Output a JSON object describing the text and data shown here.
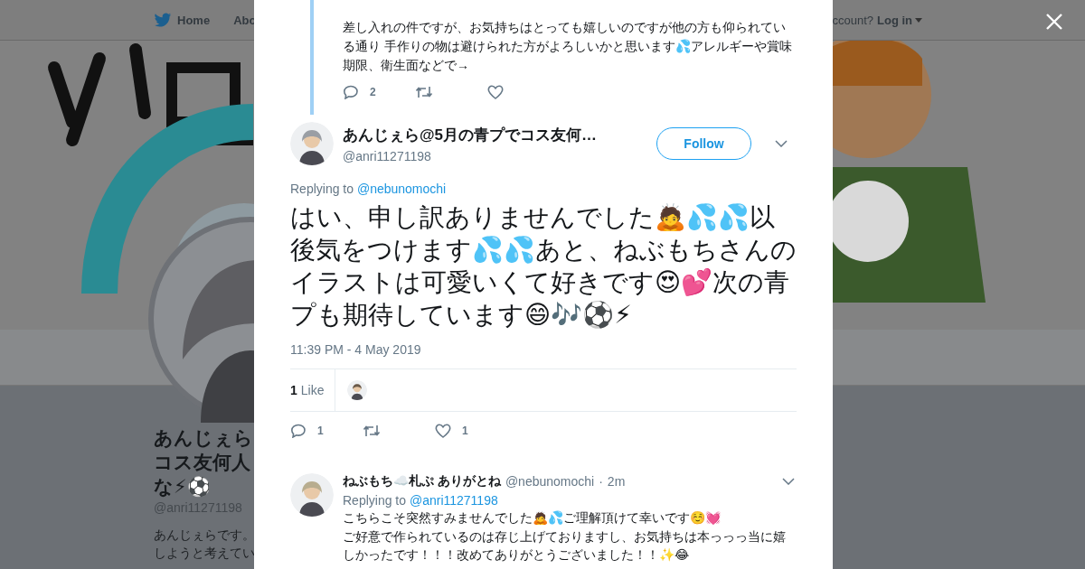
{
  "background_page": {
    "nav": [
      "Home",
      "Abo"
    ],
    "login_prompt": "ccount?",
    "login_label": "Log in",
    "profile": {
      "name_lines": [
        "あんじぇら",
        "コス友何人",
        "な⚡⚽"
      ],
      "handle": "@anri11271198",
      "bio_lines": [
        "あんじぇらです。",
        "しようと考えてい"
      ]
    }
  },
  "parent_tweet": {
    "text": "差し入れの件ですが、お気持ちはとっても嬉しいのですが他の方も仰られている通り 手作りの物は避けられた方がよろしいかと思います💦アレルギーや賞味期限、衛生面などで→",
    "actions": [
      {
        "kind": "reply",
        "count": "2"
      },
      {
        "kind": "retweet"
      },
      {
        "kind": "like"
      }
    ]
  },
  "tweet": {
    "name": "あんじぇら@5月の青プでコス友何…",
    "handle": "@anri11271198",
    "follow_label": "Follow",
    "replying_prefix": "Replying to",
    "replying_to": "@nebunomochi",
    "text": "はい、申し訳ありませんでした🙇💦💦以後気をつけます💦💦あと、ねぶもちさんのイラストは可愛いくて好きです😍💕次の青プも期待しています😄🎶⚽⚡",
    "timestamp": "11:39 PM - 4 May 2019",
    "likes_count": "1",
    "likes_label": "Like",
    "actions": [
      {
        "kind": "reply",
        "count": "1"
      },
      {
        "kind": "retweet"
      },
      {
        "kind": "like",
        "count": "1"
      }
    ]
  },
  "replies": [
    {
      "name": "ねぶもち☁️札ぷ ありがとね",
      "handle": "@nebunomochi",
      "separator": "·",
      "time": "2m",
      "replying_prefix": "Replying to",
      "replying_to": "@anri11271198",
      "lines": [
        "こちらこそ突然すみませんでした🙇💦ご理解頂けて幸いです☺️💓",
        "ご好意で作られているのは存じ上げておりますし、お気持ちは本っっっ当に嬉しかったです！！！改めてありがとうございました！！✨😂"
      ]
    }
  ]
}
